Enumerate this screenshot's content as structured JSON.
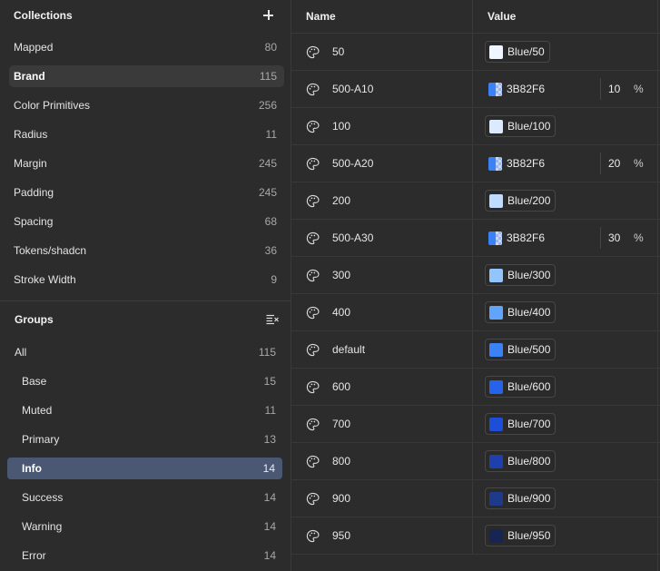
{
  "collections": {
    "title": "Collections",
    "items": [
      {
        "label": "Mapped",
        "count": "80"
      },
      {
        "label": "Brand",
        "count": "115"
      },
      {
        "label": "Color Primitives",
        "count": "256"
      },
      {
        "label": "Radius",
        "count": "11"
      },
      {
        "label": "Margin",
        "count": "245"
      },
      {
        "label": "Padding",
        "count": "245"
      },
      {
        "label": "Spacing",
        "count": "68"
      },
      {
        "label": "Tokens/shadcn",
        "count": "36"
      },
      {
        "label": "Stroke Width",
        "count": "9"
      }
    ]
  },
  "groups": {
    "title": "Groups",
    "items": [
      {
        "label": "All",
        "count": "115"
      },
      {
        "label": "Base",
        "count": "15"
      },
      {
        "label": "Muted",
        "count": "11"
      },
      {
        "label": "Primary",
        "count": "13"
      },
      {
        "label": "Info",
        "count": "14"
      },
      {
        "label": "Success",
        "count": "14"
      },
      {
        "label": "Warning",
        "count": "14"
      },
      {
        "label": "Error",
        "count": "14"
      }
    ]
  },
  "table": {
    "headers": {
      "name": "Name",
      "value": "Value"
    },
    "rows": [
      {
        "name": "50",
        "ref": "Blue/50",
        "color": "#eff6ff"
      },
      {
        "name": "500-A10",
        "hex": "3B82F6",
        "alpha": "10",
        "pct": "%",
        "color": "#3b82f6"
      },
      {
        "name": "100",
        "ref": "Blue/100",
        "color": "#dbeafe"
      },
      {
        "name": "500-A20",
        "hex": "3B82F6",
        "alpha": "20",
        "pct": "%",
        "color": "#3b82f6"
      },
      {
        "name": "200",
        "ref": "Blue/200",
        "color": "#bfdbfe"
      },
      {
        "name": "500-A30",
        "hex": "3B82F6",
        "alpha": "30",
        "pct": "%",
        "color": "#3b82f6"
      },
      {
        "name": "300",
        "ref": "Blue/300",
        "color": "#93c5fd"
      },
      {
        "name": "400",
        "ref": "Blue/400",
        "color": "#60a5fa"
      },
      {
        "name": "default",
        "ref": "Blue/500",
        "color": "#3b82f6"
      },
      {
        "name": "600",
        "ref": "Blue/600",
        "color": "#2563eb"
      },
      {
        "name": "700",
        "ref": "Blue/700",
        "color": "#1d4ed8"
      },
      {
        "name": "800",
        "ref": "Blue/800",
        "color": "#1e40af"
      },
      {
        "name": "900",
        "ref": "Blue/900",
        "color": "#1e3a8a"
      },
      {
        "name": "950",
        "ref": "Blue/950",
        "color": "#172554"
      }
    ]
  },
  "icons": {
    "add": "plus-icon",
    "collapse": "collapse-all-icon",
    "token": "palette-icon"
  }
}
